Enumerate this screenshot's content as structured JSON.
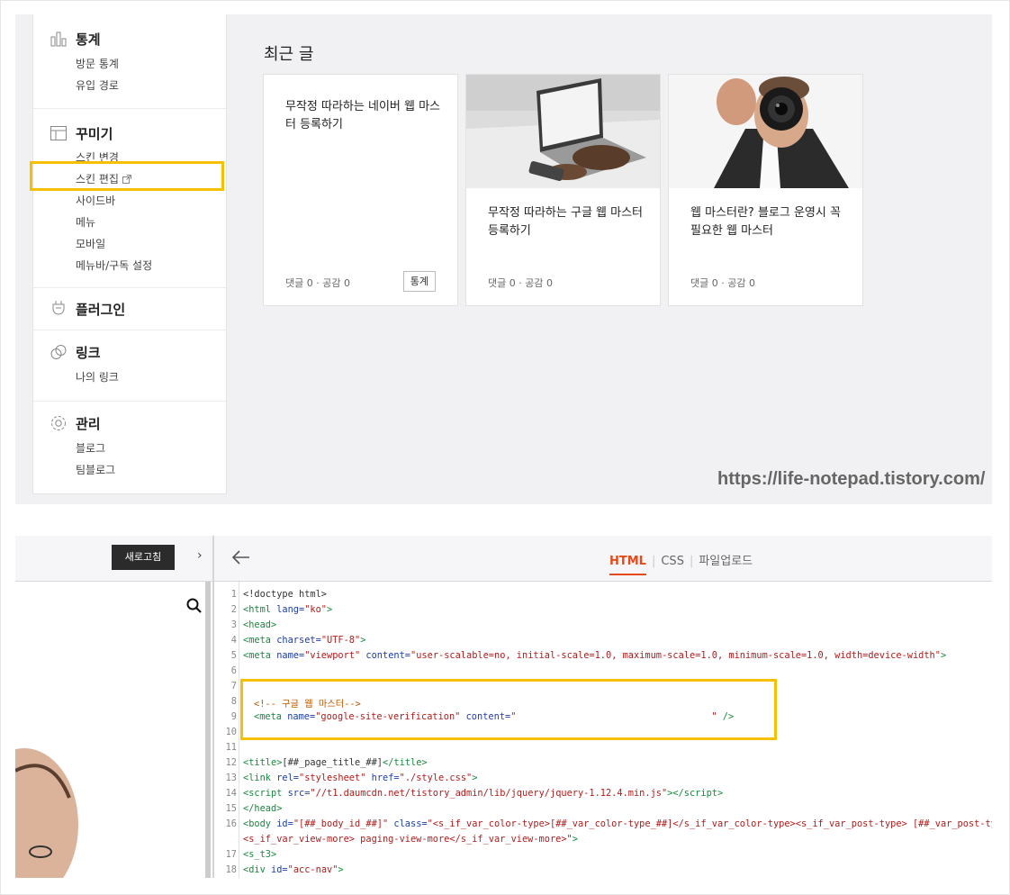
{
  "sidebar": {
    "stats": {
      "title": "통계",
      "items": [
        "방문 통계",
        "유입 경로"
      ]
    },
    "decorate": {
      "title": "꾸미기",
      "items": [
        "스킨 변경",
        "스킨 편집",
        "사이드바",
        "메뉴",
        "모바일",
        "메뉴바/구독 설정"
      ]
    },
    "plugin": {
      "title": "플러그인"
    },
    "link": {
      "title": "링크",
      "items": [
        "나의 링크"
      ]
    },
    "manage": {
      "title": "관리",
      "items": [
        "블로그",
        "팀블로그"
      ]
    }
  },
  "recent": {
    "title": "최근 글",
    "cards": [
      {
        "title": "무작정 따라하는 네이버 웹 마스터 등록하기",
        "meta": "댓글 0 · 공감 0",
        "button": "통계"
      },
      {
        "title": "무작정 따라하는 구글 웹 마스터 등록하기",
        "meta": "댓글 0 · 공감 0"
      },
      {
        "title": "웹 마스터란? 블로그 운영시 꼭 필요한 웹 마스터",
        "meta": "댓글 0 · 공감 0"
      }
    ]
  },
  "watermark": "https://life-notepad.tistory.com/",
  "editor": {
    "refresh_label": "새로고침",
    "tabs": [
      "HTML",
      "CSS",
      "파일업로드"
    ],
    "line_numbers": [
      "1",
      "2",
      "3",
      "4",
      "5",
      "6",
      "7",
      "8",
      "9",
      "10",
      "11",
      "12",
      "13",
      "14",
      "15",
      "16",
      "",
      "17",
      "18"
    ]
  },
  "colors": {
    "highlight": "#f5c000",
    "active_tab": "#e64a19"
  },
  "icons": [
    "chart-icon",
    "layout-icon",
    "plug-icon",
    "link-icon",
    "gear-icon",
    "external-link-icon",
    "search-icon",
    "back-arrow-icon",
    "chevron-right-icon"
  ]
}
